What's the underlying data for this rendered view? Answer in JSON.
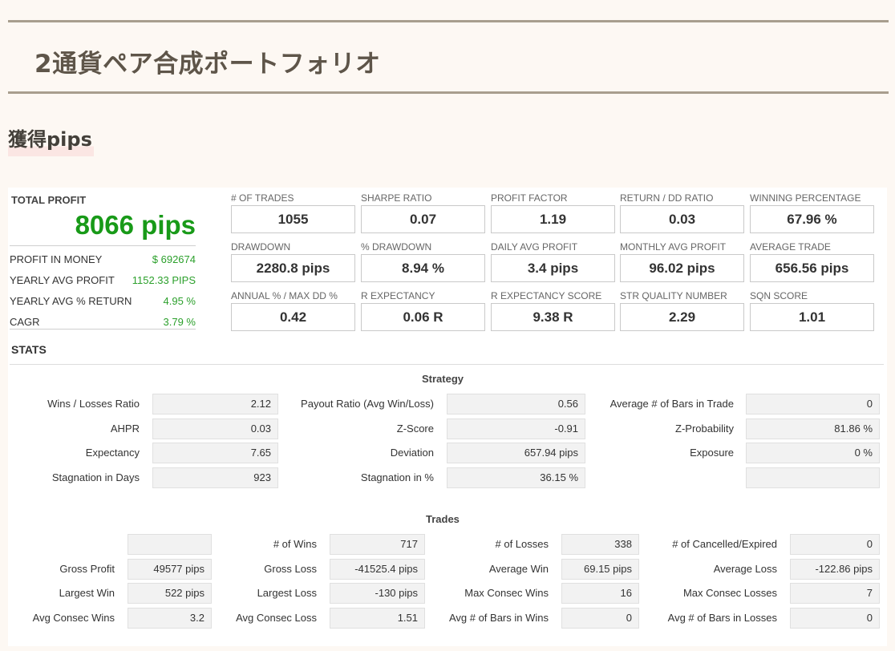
{
  "page": {
    "title": "2通貨ペア合成ポートフォリオ",
    "section": "獲得pips"
  },
  "summary": {
    "total_profit_label": "TOTAL PROFIT",
    "total_profit_value": "8066 pips",
    "rows": [
      {
        "label": "PROFIT IN MONEY",
        "value": "$ 692674"
      },
      {
        "label": "YEARLY AVG PROFIT",
        "value": "1152.33 PIPS"
      },
      {
        "label": "YEARLY AVG % RETURN",
        "value": "4.95 %"
      },
      {
        "label": "CAGR",
        "value": "3.79 %"
      }
    ]
  },
  "metrics": [
    {
      "label": "# OF TRADES",
      "value": "1055"
    },
    {
      "label": "SHARPE RATIO",
      "value": "0.07"
    },
    {
      "label": "PROFIT FACTOR",
      "value": "1.19"
    },
    {
      "label": "RETURN / DD RATIO",
      "value": "0.03"
    },
    {
      "label": "WINNING PERCENTAGE",
      "value": "67.96 %"
    },
    {
      "label": "DRAWDOWN",
      "value": "2280.8 pips"
    },
    {
      "label": "% DRAWDOWN",
      "value": "8.94 %"
    },
    {
      "label": "DAILY AVG PROFIT",
      "value": "3.4 pips"
    },
    {
      "label": "MONTHLY AVG PROFIT",
      "value": "96.02 pips"
    },
    {
      "label": "AVERAGE TRADE",
      "value": "656.56 pips"
    },
    {
      "label": "ANNUAL % / MAX DD %",
      "value": "0.42"
    },
    {
      "label": "R EXPECTANCY",
      "value": "0.06 R"
    },
    {
      "label": "R EXPECTANCY SCORE",
      "value": "9.38 R"
    },
    {
      "label": "STR QUALITY NUMBER",
      "value": "2.29"
    },
    {
      "label": "SQN SCORE",
      "value": "1.01"
    }
  ],
  "stats": {
    "label": "STATS",
    "strategy": {
      "heading": "Strategy",
      "rows": [
        [
          {
            "label": "Wins / Losses Ratio",
            "value": "2.12"
          },
          {
            "label": "Payout Ratio (Avg Win/Loss)",
            "value": "0.56"
          },
          {
            "label": "Average # of Bars in Trade",
            "value": "0"
          }
        ],
        [
          {
            "label": "AHPR",
            "value": "0.03"
          },
          {
            "label": "Z-Score",
            "value": "-0.91"
          },
          {
            "label": "Z-Probability",
            "value": "81.86 %"
          }
        ],
        [
          {
            "label": "Expectancy",
            "value": "7.65"
          },
          {
            "label": "Deviation",
            "value": "657.94 pips"
          },
          {
            "label": "Exposure",
            "value": "0 %"
          }
        ],
        [
          {
            "label": "Stagnation in Days",
            "value": "923"
          },
          {
            "label": "Stagnation in %",
            "value": "36.15 %"
          },
          {
            "label": "",
            "value": ""
          }
        ]
      ]
    },
    "trades": {
      "heading": "Trades",
      "rows": [
        [
          {
            "label": "",
            "value": ""
          },
          {
            "label": "# of Wins",
            "value": "717"
          },
          {
            "label": "# of Losses",
            "value": "338"
          },
          {
            "label": "# of Cancelled/Expired",
            "value": "0"
          }
        ],
        [
          {
            "label": "Gross Profit",
            "value": "49577 pips"
          },
          {
            "label": "Gross Loss",
            "value": "-41525.4 pips"
          },
          {
            "label": "Average Win",
            "value": "69.15 pips"
          },
          {
            "label": "Average Loss",
            "value": "-122.86 pips"
          }
        ],
        [
          {
            "label": "Largest Win",
            "value": "522 pips"
          },
          {
            "label": "Largest Loss",
            "value": "-130 pips"
          },
          {
            "label": "Max Consec Wins",
            "value": "16"
          },
          {
            "label": "Max Consec Losses",
            "value": "7"
          }
        ],
        [
          {
            "label": "Avg Consec Wins",
            "value": "3.2"
          },
          {
            "label": "Avg Consec Loss",
            "value": "1.51"
          },
          {
            "label": "Avg # of Bars in Wins",
            "value": "0"
          },
          {
            "label": "Avg # of Bars in Losses",
            "value": "0"
          }
        ]
      ]
    }
  }
}
